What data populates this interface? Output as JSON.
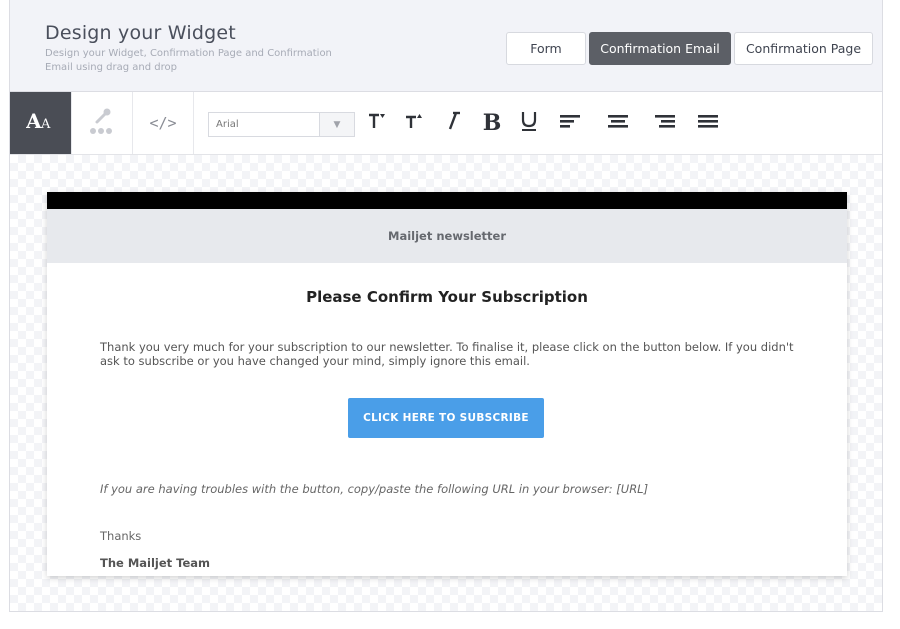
{
  "header": {
    "title": "Design your Widget",
    "subtitle": "Design your Widget, Confirmation Page and Confirmation Email using drag and drop",
    "tabs": [
      {
        "label": "Form",
        "active": false
      },
      {
        "label": "Confirmation Email",
        "active": true
      },
      {
        "label": "Confirmation Page",
        "active": false
      }
    ]
  },
  "toolbar": {
    "tool_tabs": [
      {
        "icon": "text-style-icon",
        "active": true
      },
      {
        "icon": "color-dropper-icon",
        "active": false
      },
      {
        "icon": "code-icon",
        "glyph": "</>",
        "active": false
      }
    ],
    "font_select": {
      "value": "Arial"
    },
    "format_buttons": [
      "font-size-decrease-icon",
      "font-size-increase-icon",
      "italic-icon",
      "bold-icon",
      "underline-icon",
      "align-left-icon",
      "align-center-icon",
      "align-right-icon",
      "align-justify-icon"
    ]
  },
  "email": {
    "brand_header": "Mailjet newsletter",
    "title": "Please Confirm Your Subscription",
    "body": "Thank you very much for your subscription to our newsletter. To finalise it, please click on the button below. If you didn't ask to subscribe or you have changed your mind, simply ignore this email.",
    "button_label": "CLICK HERE TO SUBSCRIBE",
    "note": "If you are having troubles with the button, copy/paste the following URL in your browser: [URL]",
    "thanks": "Thanks",
    "signature": "The Mailjet Team"
  },
  "colors": {
    "header_bg": "#f2f3f8",
    "active_tab_bg": "#5c5f66",
    "cta_bg": "#4a9ee8",
    "email_topbar": "#000000",
    "email_header_bg": "#e7e9ed"
  }
}
